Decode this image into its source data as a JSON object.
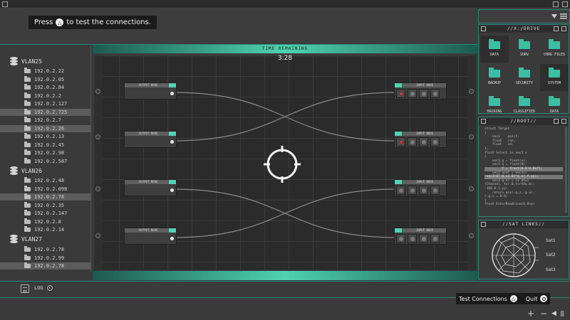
{
  "hint": {
    "prefix": "Press",
    "button": "△",
    "suffix": "to test the connections."
  },
  "sidebar": {
    "vlans": [
      {
        "name": "VLAN25",
        "ips": [
          "192.0.2.22",
          "192.0.2.05",
          "192.0.2.84",
          "192.0.2.2",
          "192.0.2.127",
          "192.0.2.725",
          "192.0.2.7",
          "192.0.2.26",
          "192.0.2.13",
          "192.0.2.45",
          "192.0.2.98",
          "192.0.2.587"
        ],
        "highlighted": [
          5,
          7
        ]
      },
      {
        "name": "VLAN26",
        "ips": [
          "192.0.2.48",
          "192.0.2.098",
          "192.0.2.78",
          "192.0.2.35",
          "192.0.2.147",
          "192.0.2.8",
          "192.0.2.14"
        ],
        "highlighted": [
          2
        ]
      },
      {
        "name": "VLAN27",
        "ips": [
          "192.0.2.78",
          "192.0.2.99",
          "192.0.2.78"
        ],
        "highlighted": [
          2
        ]
      }
    ]
  },
  "board": {
    "timer_label": "TIME REMAINING",
    "timer_value": "3:28",
    "output_label": "OUTPUT NODE",
    "input_label": "INPUT NODE"
  },
  "drive": {
    "title": "//X:/DRIVE",
    "items": [
      {
        "label": "DATA",
        "selected": true
      },
      {
        "label": "SURV",
        "selected": false
      },
      {
        "label": "CHRG FILES",
        "selected": false
      },
      {
        "label": "BACKUP",
        "selected": false
      },
      {
        "label": "SECURITY",
        "selected": false
      },
      {
        "label": "SYSTEM",
        "selected": true
      },
      {
        "label": "HACKING",
        "selected": false
      },
      {
        "label": "CLASSIFIED",
        "selected": false
      },
      {
        "label": "DATA",
        "selected": false
      }
    ]
  },
  "root": {
    "title": "//ROOT//",
    "code_lines": [
      "struct Target",
      "{",
      "    vec3    posit;",
      "    float   ran;",
      "    float   id;",
      "};",
      "",
      "float Select in vec3 x",
      "{",
      "    vec3.g = float(x);",
      "    vec3.q = float(0);",
      "         f = fract(0.8-0.8xf);",
      "",
      "    vec3 aval = vec3(x",
      "-vec3(87.0,x1.0)*q.z),f.xy);",
      "    vec3 g.tr = (x.atu)",
      "(Channel, tvr.0,tirXXu.0);",
      "-100.0.1.yy;",
      "    return mix(-g.z,-g.x),",
      "r.g.c = 0.0;",
      "}",
      "",
      "float EnterReadline(0.0rp)"
    ],
    "highlight_lines": [
      11,
      14
    ]
  },
  "sat": {
    "title": "//SAT LINKS//",
    "links": [
      "Sat1",
      "Sat2",
      "Sat3"
    ]
  },
  "bottom": {
    "log_label": "LOG",
    "log_close": "✕",
    "test_label": "Test Connections",
    "test_button": "△",
    "quit_label": "Quit",
    "ctrl_plus": "+",
    "ctrl_minus": "−",
    "ctrl_back": "◀",
    "ctrl_bars": "|||"
  },
  "colors": {
    "accent": "#4fd3b0",
    "accent_dark": "#1d5a4f",
    "warning_port": "#d23030",
    "panel_bg": "#3a3a3a",
    "board_bg": "#2b2b2b"
  },
  "icons": {
    "menu": "hamburger-icon",
    "sort": "triangle-down-icon",
    "database": "database-icon",
    "folder": "folder-icon",
    "reticle": "crosshair-reticle-icon",
    "satellite": "satellite-web-icon"
  }
}
